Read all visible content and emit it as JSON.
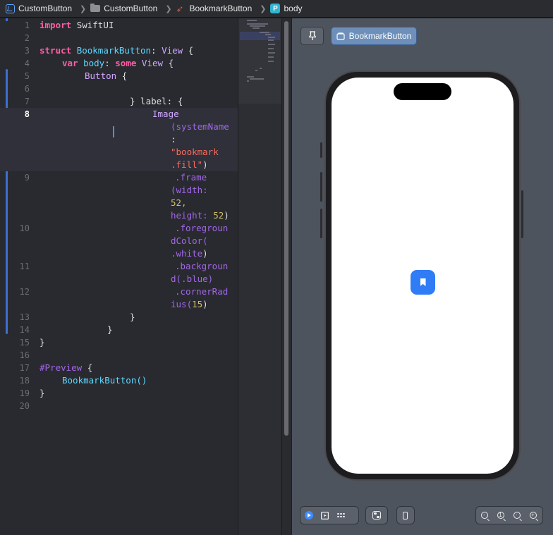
{
  "breadcrumb": {
    "items": [
      {
        "label": "CustomButton",
        "icon": "app-icon"
      },
      {
        "label": "CustomButton",
        "icon": "folder-icon"
      },
      {
        "label": "BookmarkButton",
        "icon": "swift-file-icon"
      },
      {
        "label": "body",
        "icon": "property-icon"
      }
    ],
    "property_badge": "P"
  },
  "editor": {
    "current_line": "8",
    "lines": [
      {
        "n": "1"
      },
      {
        "n": "2"
      },
      {
        "n": "3"
      },
      {
        "n": "4"
      },
      {
        "n": "5"
      },
      {
        "n": "6"
      },
      {
        "n": "7"
      },
      {
        "n": "8"
      },
      {
        "n": "9"
      },
      {
        "n": "10"
      },
      {
        "n": "11"
      },
      {
        "n": "12"
      },
      {
        "n": "13"
      },
      {
        "n": "14"
      },
      {
        "n": "15"
      },
      {
        "n": "16"
      },
      {
        "n": "17"
      },
      {
        "n": "18"
      },
      {
        "n": "19"
      },
      {
        "n": "20"
      }
    ],
    "tokens": {
      "import_kw": "import",
      "import_mod": "SwiftUI",
      "struct_kw": "struct",
      "struct_name": "BookmarkButton",
      "colon_view": ":",
      "view_type": "View",
      "open_brace": "{",
      "var_kw": "var",
      "body_name": "body",
      "some_kw": "some",
      "button_type": "Button",
      "close_label": "} label: {",
      "image_type": "Image",
      "system_name_a": "(systemName",
      "system_name_b": ":",
      "str_a": "\"bookmark",
      "str_b": ".fill\"",
      "paren_close": ")",
      "frame_a": ".frame",
      "frame_b": "(width:",
      "frame_num_a": "52,",
      "frame_c": "height:",
      "frame_num_b": "52",
      "fg_a": ".foregroun",
      "fg_b": "dColor(",
      "fg_c": ".white",
      "bg_a": ".backgroun",
      "bg_b": "d(.blue)",
      "cr_a": ".cornerRad",
      "cr_b": "ius(",
      "cr_num": "15",
      "close_brace": "}",
      "preview_macro": "#Preview",
      "preview_call": "BookmarkButton()"
    }
  },
  "preview": {
    "pin_icon": "pin-icon",
    "selected_view_label": "BookmarkButton",
    "button_color": "#2f7cf6",
    "button_icon": "bookmark-fill-icon"
  },
  "toolbar": {
    "mode_icons": [
      "live-play-icon",
      "selectable-icon",
      "variants-grid-icon"
    ],
    "settings_icon": "canvas-settings-icon",
    "device_icon": "device-icon",
    "zoom_icons": [
      "zoom-out-icon",
      "zoom-100-icon",
      "zoom-fit-icon",
      "zoom-in-icon"
    ]
  }
}
